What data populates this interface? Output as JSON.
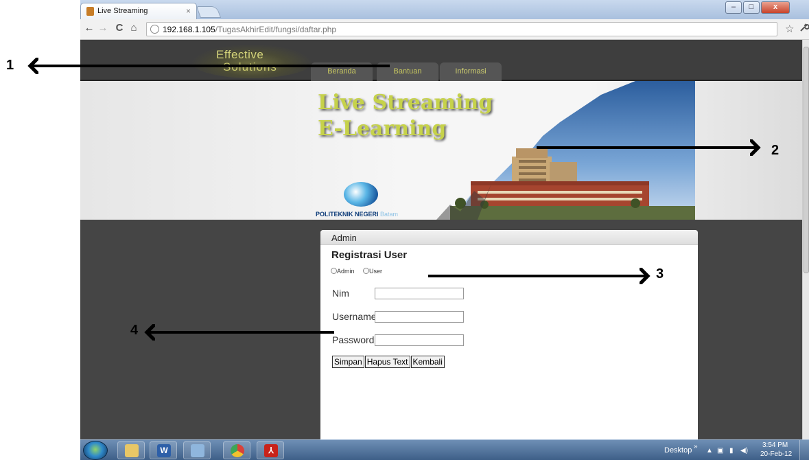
{
  "browser": {
    "tab_title": "Live Streaming",
    "tab_close": "×",
    "url_host": "192.168.1.105",
    "url_path": "/TugasAkhirEdit/fungsi/daftar.php",
    "controls": {
      "minimize": "–",
      "maximize": "□",
      "close": "x"
    },
    "nav": {
      "back": "←",
      "forward": "→",
      "reload": "C",
      "home": "⌂",
      "bookmark": "☆",
      "settings": "🔧"
    }
  },
  "site": {
    "logo_line1": "Effective",
    "logo_line2": "Solutions",
    "menu": [
      "Beranda",
      "Bantuan",
      "Informasi"
    ],
    "banner_title_1": "Live Streaming",
    "banner_title_2": "E-Learning",
    "institution": "POLITEKNIK NEGERI",
    "institution_city": "Batam"
  },
  "panel": {
    "header": "Admin",
    "title": "Registrasi User",
    "radio_options": [
      "Admin",
      "User"
    ],
    "fields": [
      {
        "label": "Nim",
        "value": ""
      },
      {
        "label": "Username",
        "value": ""
      },
      {
        "label": "Password",
        "value": ""
      }
    ],
    "buttons": [
      "Simpan",
      "Hapus Text",
      "Kembali"
    ]
  },
  "annotations": [
    "1",
    "2",
    "3",
    "4"
  ],
  "taskbar": {
    "apps": [
      "explorer",
      "word",
      "control-panel",
      "chrome",
      "acrobat"
    ],
    "desktop_label": "Desktop",
    "overflow": "»",
    "time": "3:54 PM",
    "date": "20-Feb-12"
  },
  "colors": {
    "page_bg": "#454545",
    "banner_title": "#c6d24a",
    "menu_text": "#c9c960",
    "annotation_arrow": "#000000"
  }
}
